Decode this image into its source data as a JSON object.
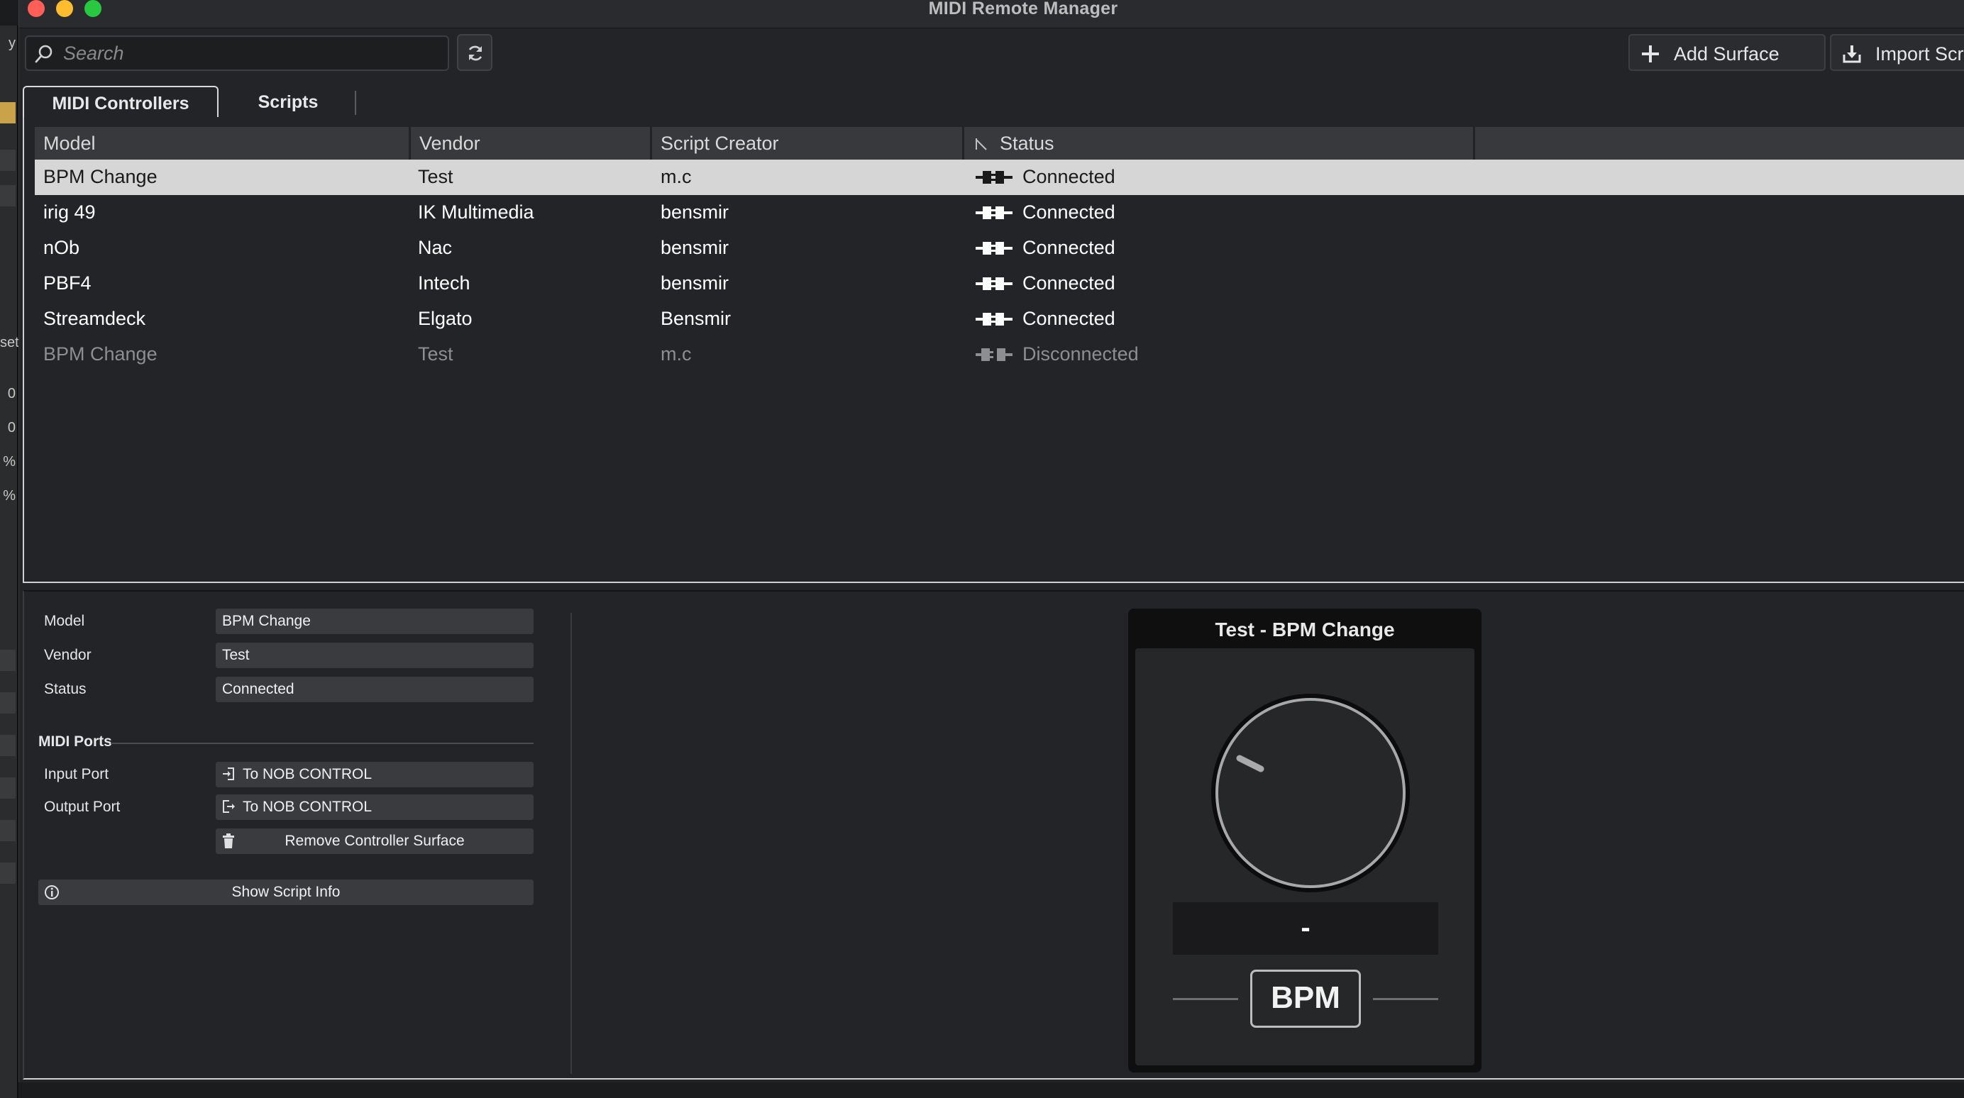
{
  "window": {
    "title": "MIDI Remote Manager"
  },
  "toolbar": {
    "search_placeholder": "Search",
    "add_surface_label": "Add Surface",
    "import_script_label": "Import Scri"
  },
  "tabs": [
    {
      "label": "MIDI Controllers",
      "active": true
    },
    {
      "label": "Scripts",
      "active": false
    }
  ],
  "table": {
    "columns": [
      "Model",
      "Vendor",
      "Script Creator",
      "Status"
    ],
    "rows": [
      {
        "model": "BPM Change",
        "vendor": "Test",
        "creator": "m.c",
        "status": "Connected",
        "selected": true
      },
      {
        "model": "irig 49",
        "vendor": "IK Multimedia",
        "creator": "bensmir",
        "status": "Connected"
      },
      {
        "model": "nOb",
        "vendor": "Nac",
        "creator": "bensmir",
        "status": "Connected"
      },
      {
        "model": "PBF4",
        "vendor": "Intech",
        "creator": "bensmir",
        "status": "Connected"
      },
      {
        "model": "Streamdeck",
        "vendor": "Elgato",
        "creator": "Bensmir",
        "status": "Connected"
      },
      {
        "model": "BPM Change",
        "vendor": "Test",
        "creator": "m.c",
        "status": "Disconnected",
        "dim": true
      }
    ]
  },
  "details": {
    "model_label": "Model",
    "model_value": "BPM Change",
    "vendor_label": "Vendor",
    "vendor_value": "Test",
    "status_label": "Status",
    "status_value": "Connected",
    "midi_ports_heading": "MIDI Ports",
    "input_port_label": "Input Port",
    "input_port_value": "To NOB CONTROL",
    "output_port_label": "Output Port",
    "output_port_value": "To NOB CONTROL",
    "remove_button_label": "Remove Controller Surface",
    "script_info_button_label": "Show Script Info"
  },
  "device": {
    "title": "Test - BPM Change",
    "value_display": "-",
    "knob_label": "BPM"
  },
  "background_app": {
    "edge_chars": [
      "y",
      "set",
      "0",
      "0",
      "%",
      "%"
    ]
  },
  "colors": {
    "window_bg": "#232427",
    "selected_row_bg": "#d6d6d6",
    "close": "#ff5f57",
    "minimize": "#febc2e",
    "zoom": "#28c840"
  }
}
